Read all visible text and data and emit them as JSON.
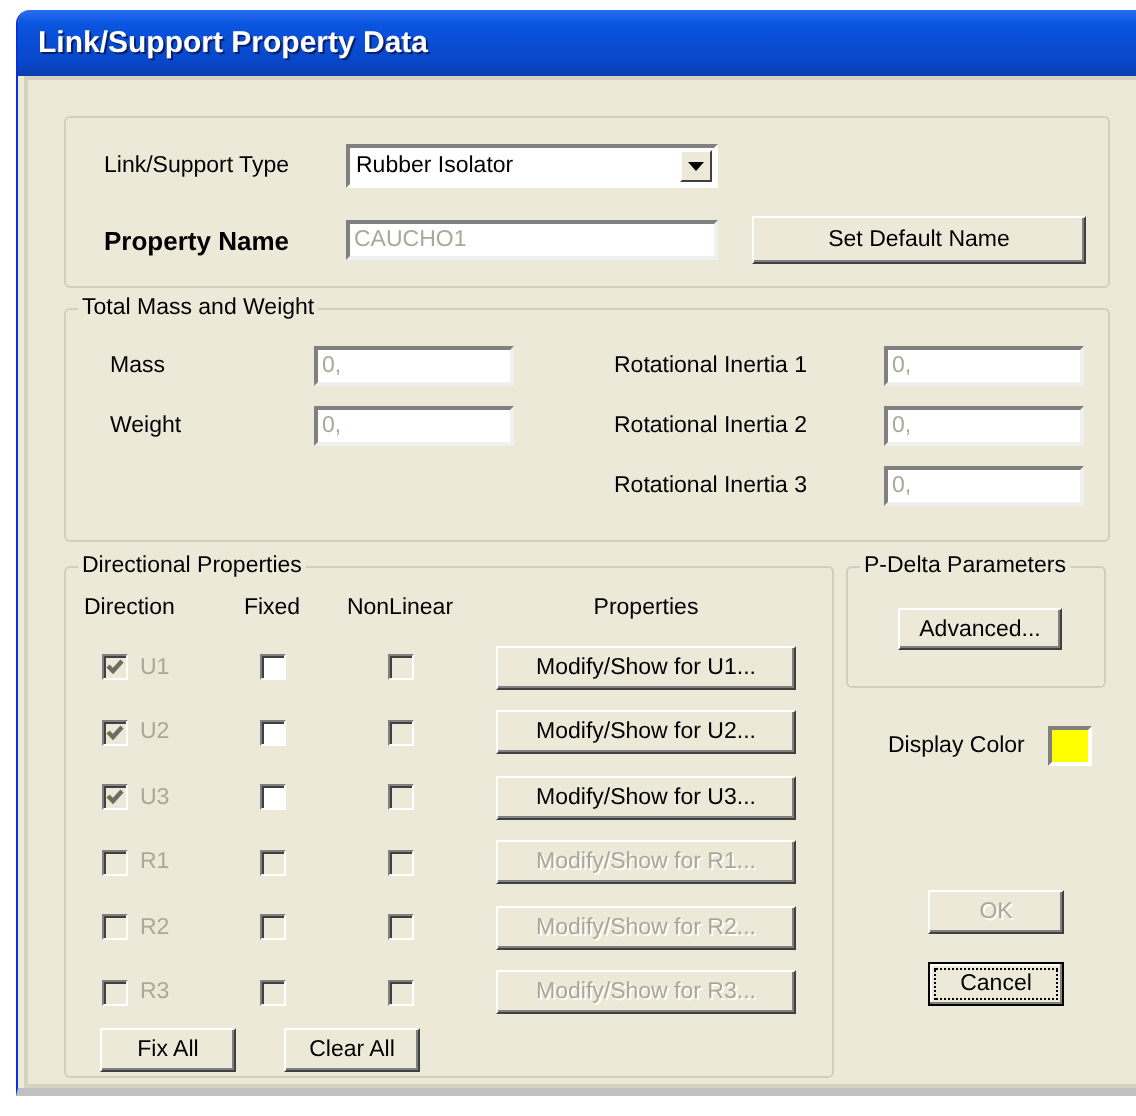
{
  "window": {
    "title": "Link/Support Property Data"
  },
  "type_field": {
    "label": "Link/Support Type",
    "value": "Rubber Isolator"
  },
  "name_field": {
    "label": "Property Name",
    "value": "CAUCHO1",
    "disabled": true
  },
  "set_default_button": {
    "label": "Set Default Name"
  },
  "mass_group": {
    "title": "Total Mass and Weight",
    "left_fields": [
      {
        "label": "Mass",
        "value": "0,",
        "disabled": true
      },
      {
        "label": "Weight",
        "value": "0,",
        "disabled": true
      }
    ],
    "right_fields": [
      {
        "label": "Rotational Inertia 1",
        "value": "0,",
        "disabled": true
      },
      {
        "label": "Rotational Inertia 2",
        "value": "0,",
        "disabled": true
      },
      {
        "label": "Rotational Inertia 3",
        "value": "0,",
        "disabled": true
      }
    ]
  },
  "directional_group": {
    "title": "Directional Properties",
    "columns": [
      "Direction",
      "Fixed",
      "NonLinear",
      "Properties"
    ],
    "rows": [
      {
        "direction": "U1",
        "direction_checked": true,
        "direction_disabled": true,
        "fixed_checked": false,
        "fixed_disabled": false,
        "nonlinear_checked": false,
        "nonlinear_disabled": true,
        "button": "Modify/Show for U1...",
        "button_disabled": false
      },
      {
        "direction": "U2",
        "direction_checked": true,
        "direction_disabled": true,
        "fixed_checked": false,
        "fixed_disabled": false,
        "nonlinear_checked": false,
        "nonlinear_disabled": true,
        "button": "Modify/Show for U2...",
        "button_disabled": false
      },
      {
        "direction": "U3",
        "direction_checked": true,
        "direction_disabled": true,
        "fixed_checked": false,
        "fixed_disabled": false,
        "nonlinear_checked": false,
        "nonlinear_disabled": true,
        "button": "Modify/Show for U3...",
        "button_disabled": false
      },
      {
        "direction": "R1",
        "direction_checked": false,
        "direction_disabled": true,
        "fixed_checked": false,
        "fixed_disabled": true,
        "nonlinear_checked": false,
        "nonlinear_disabled": true,
        "button": "Modify/Show for R1...",
        "button_disabled": true
      },
      {
        "direction": "R2",
        "direction_checked": false,
        "direction_disabled": true,
        "fixed_checked": false,
        "fixed_disabled": true,
        "nonlinear_checked": false,
        "nonlinear_disabled": true,
        "button": "Modify/Show for R2...",
        "button_disabled": true
      },
      {
        "direction": "R3",
        "direction_checked": false,
        "direction_disabled": true,
        "fixed_checked": false,
        "fixed_disabled": true,
        "nonlinear_checked": false,
        "nonlinear_disabled": true,
        "button": "Modify/Show for R3...",
        "button_disabled": true
      }
    ],
    "buttons": [
      "Fix All",
      "Clear All"
    ]
  },
  "pdelta_group": {
    "title": "P-Delta Parameters",
    "button": "Advanced..."
  },
  "display_color": {
    "label": "Display Color",
    "color": "#ffff00"
  },
  "dialog_buttons": [
    {
      "label": "OK",
      "disabled": true,
      "focused": false
    },
    {
      "label": "Cancel",
      "disabled": false,
      "focused": true
    }
  ]
}
